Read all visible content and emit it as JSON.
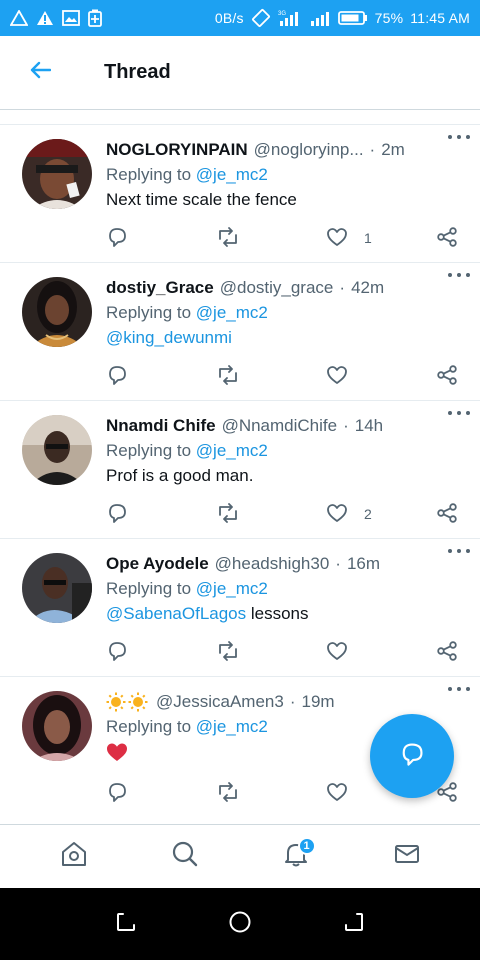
{
  "statusbar": {
    "net_speed": "0B/s",
    "battery": "75%",
    "time": "11:45 AM"
  },
  "header": {
    "title": "Thread"
  },
  "tweets": [
    {
      "name": "NOGLORYINPAIN",
      "handle": "@nogloryinp...",
      "sep": "·",
      "time": "2m",
      "replying": "Replying to",
      "reply_to": "@je_mc2",
      "text": "Next time scale the fence",
      "likes": "1"
    },
    {
      "name": "dostiy_Grace",
      "handle": "@dostiy_grace",
      "sep": "·",
      "time": "42m",
      "replying": "Replying to",
      "reply_to": "@je_mc2",
      "mention": "@king_dewunmi"
    },
    {
      "name": "Nnamdi Chife",
      "handle": "@NnamdiChife",
      "sep": "·",
      "time": "14h",
      "replying": "Replying to",
      "reply_to": "@je_mc2",
      "text": "Prof is a good man.",
      "likes": "2"
    },
    {
      "name": "Ope Ayodele",
      "handle": "@headshigh30",
      "sep": "·",
      "time": "16m",
      "replying": "Replying to",
      "reply_to": "@je_mc2",
      "mention": "@SabenaOfLagos",
      "text": "lessons"
    },
    {
      "handle": "@JessicaAmen3",
      "sep": "·",
      "time": "19m",
      "replying": "Replying to",
      "reply_to": "@je_mc2",
      "emoji": "heart"
    }
  ],
  "bottomnav": {
    "notifications_badge": "1"
  },
  "colors": {
    "accent": "#1da1f2",
    "mention": "#1b95e0",
    "muted": "#536471",
    "heart": "#e0245e"
  }
}
